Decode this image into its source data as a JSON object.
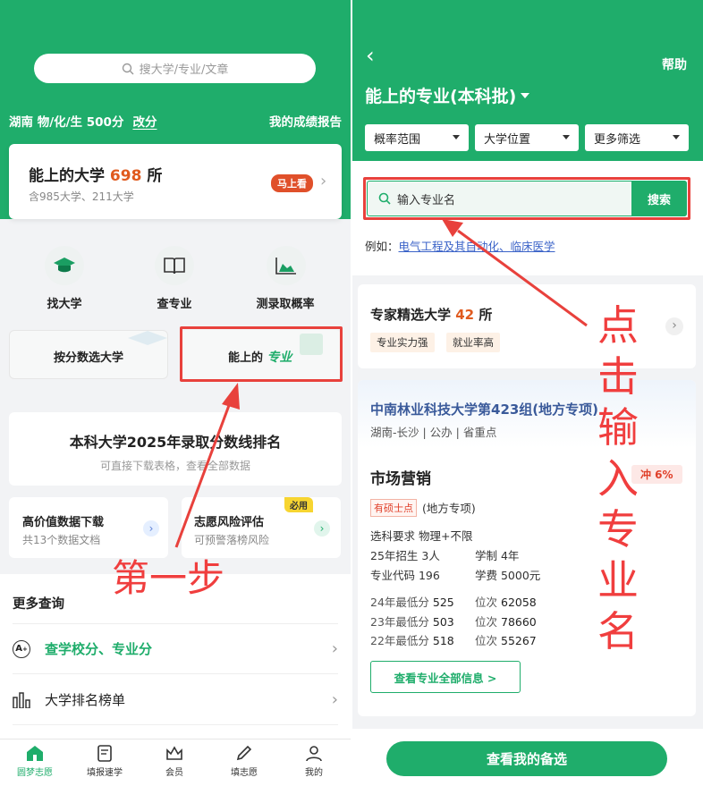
{
  "left": {
    "search_placeholder": "搜大学/专业/文章",
    "score_profile": "湖南 物/化/生 500分",
    "change_score": "改分",
    "my_report": "我的成绩报告",
    "reachable_card": {
      "prefix": "能上的大学",
      "count": "698",
      "suffix": "所",
      "subtitle": "含985大学、211大学",
      "button": "马上看"
    },
    "quick_links": [
      "找大学",
      "查专业",
      "测录取概率"
    ],
    "tile_score_pick": "按分数选大学",
    "tile_reachable_major": {
      "prefix": "能上的",
      "highlight": "专业"
    },
    "ranking_banner": {
      "title": "本科大学2025年录取分数线排名",
      "subtitle": "可直接下载表格，查看全部数据"
    },
    "data_download": {
      "title": "高价值数据下载",
      "subtitle": "共13个数据文档"
    },
    "risk_eval": {
      "title": "志愿风险评估",
      "subtitle": "可预警落榜风险",
      "badge": "必用"
    },
    "more_query_title": "更多查询",
    "more_rows": [
      "查学校分、专业分",
      "大学排名榜单"
    ],
    "annotation": "第一步",
    "tabs": [
      "圆梦志愿",
      "填报速学",
      "会员",
      "填志愿",
      "我的"
    ]
  },
  "right": {
    "back": "‹",
    "help": "帮助",
    "title": "能上的专业(本科批)",
    "filters": [
      "概率范围",
      "大学位置",
      "更多筛选"
    ],
    "major_search_placeholder": "输入专业名",
    "search_button": "搜索",
    "example_prefix": "例如：",
    "example_links": "电气工程及其自动化、临床医学",
    "expert_card": {
      "prefix": "专家精选大学",
      "count": "42",
      "suffix": "所",
      "tags": [
        "专业实力强",
        "就业率高"
      ]
    },
    "school_card": {
      "school": "中南林业科技大学第423组(地方专项)",
      "meta": "湖南-长沙 | 公办 | 省重点",
      "major": "市场营销",
      "rush_badge": "冲 6%",
      "master_tag": "有硕士点",
      "special": "(地方专项)",
      "subject_req": "选科要求 物理+不限",
      "enroll": "25年招生 3人",
      "years": "学制 4年",
      "code": "专业代码 196",
      "fee": "学费 5000元",
      "history": [
        {
          "year": "24年最低分",
          "score": "525",
          "rank_label": "位次",
          "rank": "62058"
        },
        {
          "year": "23年最低分",
          "score": "503",
          "rank_label": "位次",
          "rank": "78660"
        },
        {
          "year": "22年最低分",
          "score": "518",
          "rank_label": "位次",
          "rank": "55267"
        }
      ],
      "view_all": "查看专业全部信息 >"
    },
    "bottom_button": "查看我的备选",
    "annotation_chars": [
      "点",
      "击",
      "输",
      "入",
      "专",
      "业",
      "名"
    ]
  },
  "colors": {
    "brand_green": "#1fad6b",
    "accent_orange": "#e05a1e",
    "annotation_red": "#e8413c"
  }
}
